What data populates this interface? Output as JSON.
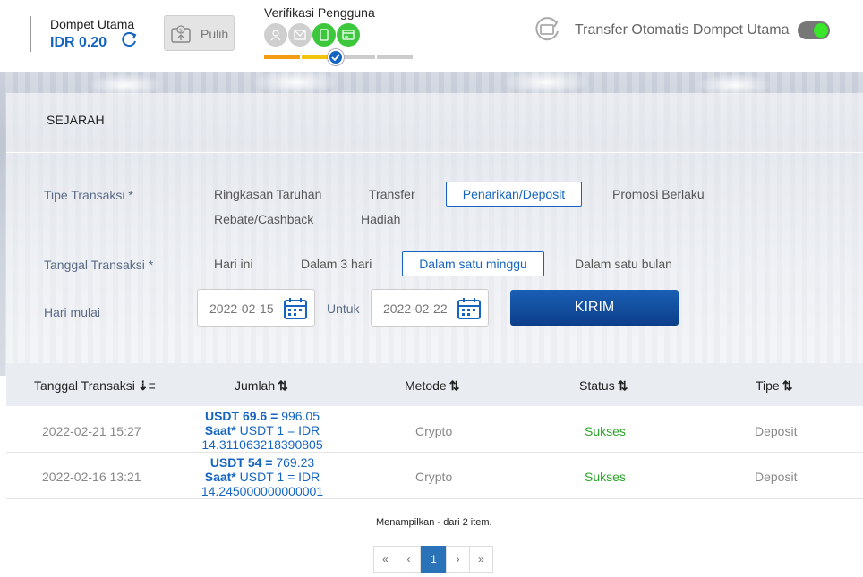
{
  "header": {
    "wallet_label": "Dompet Utama",
    "wallet_value": "IDR 0.20",
    "pulih_label": "Pulih",
    "verif_title": "Verifikasi Pengguna",
    "auto_transfer_label": "Transfer Otomatis Dompet Utama",
    "auto_transfer_on": true
  },
  "panel": {
    "title": "SEJARAH",
    "tipe_label": "Tipe Transaksi *",
    "tipe_options": [
      "Ringkasan Taruhan",
      "Transfer",
      "Penarikan/Deposit",
      "Promosi Berlaku",
      "Rebate/Cashback",
      "Hadiah"
    ],
    "tipe_selected": "Penarikan/Deposit",
    "tanggal_label": "Tanggal Transaksi *",
    "tanggal_options": [
      "Hari ini",
      "Dalam 3 hari",
      "Dalam satu minggu",
      "Dalam satu bulan"
    ],
    "tanggal_selected": "Dalam satu minggu",
    "start_label": "Hari mulai",
    "start_date": "2022-02-15",
    "untuk_label": "Untuk",
    "end_date": "2022-02-22",
    "submit_label": "KIRIM"
  },
  "table": {
    "headers": [
      "Tanggal Transaksi",
      "Jumlah",
      "Metode",
      "Status",
      "Tipe"
    ],
    "rows": [
      {
        "date": "2022-02-21 15:27",
        "amount_usdt": "USDT 69.6 =",
        "amount_idr": "996.05",
        "rate_label": "Saat*",
        "rate_text": "USDT 1 = IDR",
        "rate_value": "14.311063218390805",
        "method": "Crypto",
        "status": "Sukses",
        "type": "Deposit"
      },
      {
        "date": "2022-02-16 13:21",
        "amount_usdt": "USDT 54 =",
        "amount_idr": "769.23",
        "rate_label": "Saat*",
        "rate_text": "USDT 1 = IDR",
        "rate_value": "14.245000000000001",
        "method": "Crypto",
        "status": "Sukses",
        "type": "Deposit"
      }
    ]
  },
  "footer": {
    "showing_text": "Menampilkan - dari 2 item.",
    "pages": [
      "«",
      "‹",
      "1",
      "›",
      "»"
    ],
    "current_page": "1"
  },
  "colors": {
    "accent": "#1565c0",
    "success": "#2aa52a",
    "verified": "#3dc73d",
    "toggle_on": "#39e62a"
  }
}
